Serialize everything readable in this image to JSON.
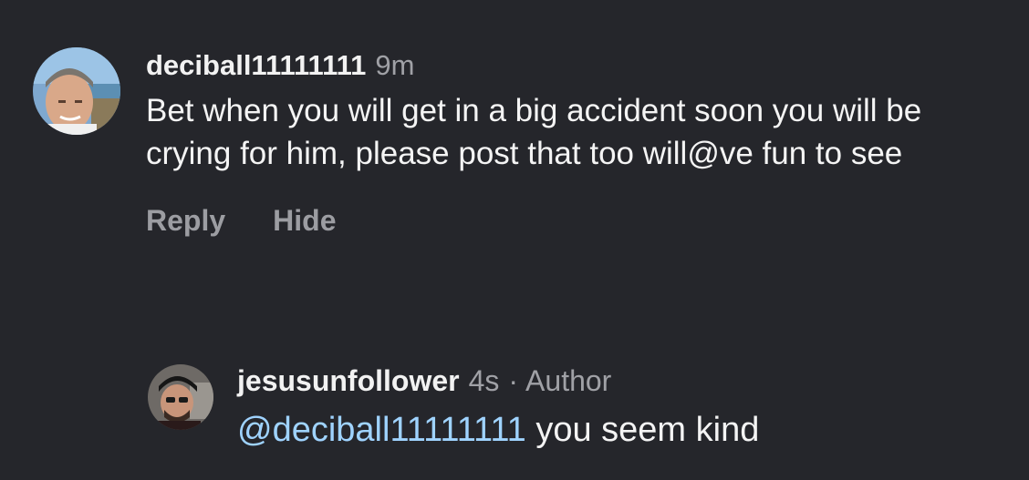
{
  "comments": [
    {
      "username": "deciball11111111",
      "time": "9m",
      "text": "Bet when you will get in a big accident soon you will be crying for him, please post that too will@ve fun to see",
      "actions": {
        "reply": "Reply",
        "hide": "Hide"
      }
    },
    {
      "username": "jesusunfollower",
      "time": "4s",
      "separator": "·",
      "badge": "Author",
      "mention": "@deciball11111111",
      "text": " you seem kind"
    }
  ],
  "colors": {
    "background": "#25262b",
    "mention": "#9fd3ff",
    "muted": "#a0a1a6"
  }
}
